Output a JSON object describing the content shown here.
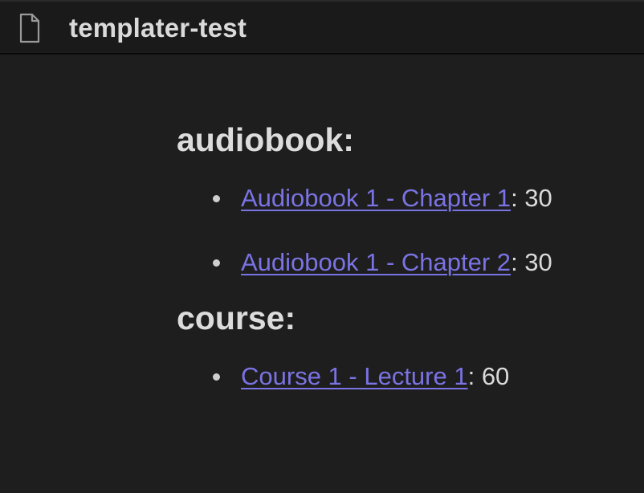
{
  "window": {
    "title": "templater-test"
  },
  "sections": [
    {
      "heading": "audiobook:",
      "items": [
        {
          "link": "Audiobook 1 - Chapter 1",
          "value": ": 30"
        },
        {
          "link": "Audiobook 1 - Chapter 2",
          "value": ": 30"
        }
      ]
    },
    {
      "heading": "course:",
      "items": [
        {
          "link": "Course 1 - Lecture 1",
          "value": ": 60"
        }
      ]
    }
  ],
  "colors": {
    "background": "#1e1e1e",
    "titlebar": "#1a1a1a",
    "text": "#dadada",
    "link": "#7a73e3"
  },
  "icons": {
    "file": "file-icon"
  }
}
